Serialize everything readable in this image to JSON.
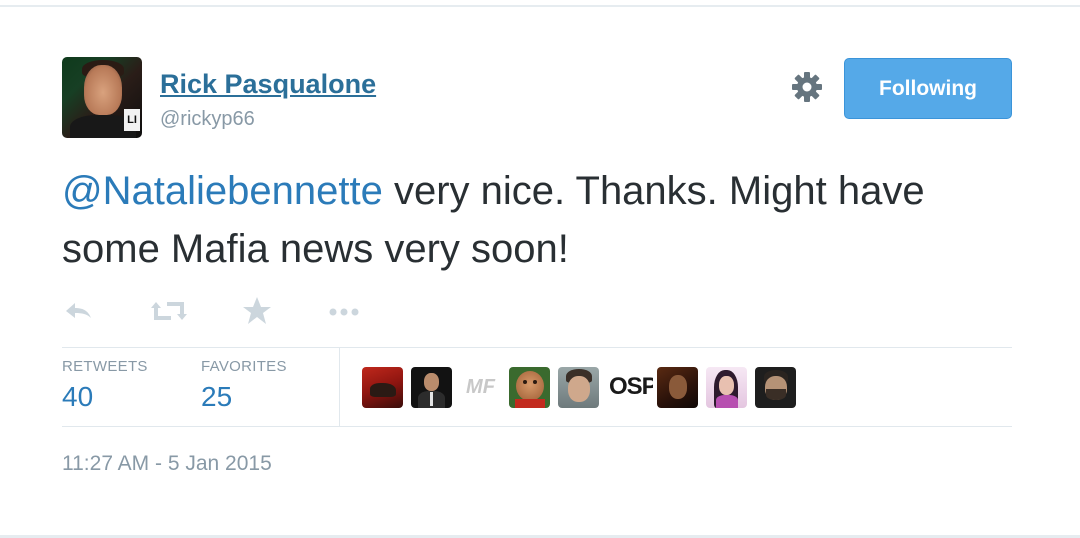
{
  "user": {
    "display_name": "Rick Pasqualone",
    "handle": "@rickyp66",
    "avatar_icon": "profile-photo"
  },
  "header": {
    "follow_label": "Following",
    "settings_icon": "gear-icon"
  },
  "tweet": {
    "mention": "@Nataliebennette",
    "text": " very nice. Thanks. Might have some Mafia news very soon!"
  },
  "actions": [
    "reply-icon",
    "retweet-icon",
    "favorite-icon",
    "more-icon"
  ],
  "stats": {
    "retweets_label": "RETWEETS",
    "retweets_count": "40",
    "favorites_label": "FAVORITES",
    "favorites_count": "25"
  },
  "favoriters": {
    "osp_label": "OSP",
    "mf_label": "MF"
  },
  "timestamp": "11:27 AM - 5 Jan 2015",
  "colors": {
    "link": "#2b7bb9",
    "follow_button": "#55a9e8",
    "muted": "#8899a6",
    "text": "#292f33"
  }
}
